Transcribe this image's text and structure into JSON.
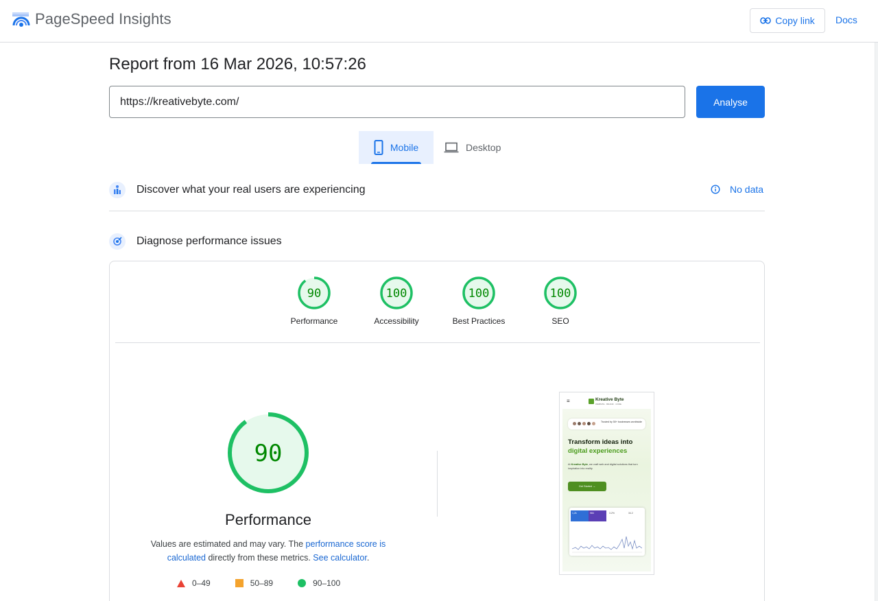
{
  "app": {
    "brand": "PageSpeed Insights",
    "copy_link": "Copy link",
    "docs": "Docs"
  },
  "report": {
    "title": "Report from 16 Mar 2026, 10:57:26",
    "url": "https://kreativebyte.com/",
    "analyse": "Analyse"
  },
  "tabs": [
    {
      "label": "Mobile",
      "selected": true
    },
    {
      "label": "Desktop",
      "selected": false
    }
  ],
  "sections": {
    "real_users": {
      "title": "Discover what your real users are experiencing",
      "status": "No data"
    },
    "diagnose": {
      "title": "Diagnose performance issues"
    }
  },
  "scores": [
    {
      "label": "Performance",
      "value": "90"
    },
    {
      "label": "Accessibility",
      "value": "100"
    },
    {
      "label": "Best Practices",
      "value": "100"
    },
    {
      "label": "SEO",
      "value": "100"
    }
  ],
  "performance": {
    "score": "90",
    "title": "Performance",
    "desc_1": "Values are estimated and may vary. The ",
    "link_1": "performance score is calculated",
    "desc_2": " directly from these metrics. ",
    "link_2": "See calculator",
    "desc_3": "."
  },
  "legend": [
    {
      "range": "0–49",
      "color": "#e94235",
      "shape": "triangle"
    },
    {
      "range": "50–89",
      "color": "#f4a32d",
      "shape": "square"
    },
    {
      "range": "90–100",
      "color": "#1ec064",
      "shape": "circle"
    }
  ],
  "colors": {
    "accent": "#1a73e8",
    "pass": "#1ec064",
    "pass_bg": "#e6f9ec",
    "pass_text": "#008800"
  },
  "screenshot": {
    "brand": "Kreative Byte",
    "tagline": "WEBSITE · BRAND · CODE",
    "trust": "Trusted by 50+ businesses worldwide",
    "headline_1": "Transform ideas into",
    "headline_2": "digital experiences",
    "body_prefix": "At ",
    "body_brand": "Kreative Byte",
    "body_rest": ", we craft web and digital solutions that turn inspiration into reality.",
    "cta": "Get Started →",
    "stats": [
      "1,2k",
      "984",
      "3.2%",
      "34.2"
    ]
  }
}
